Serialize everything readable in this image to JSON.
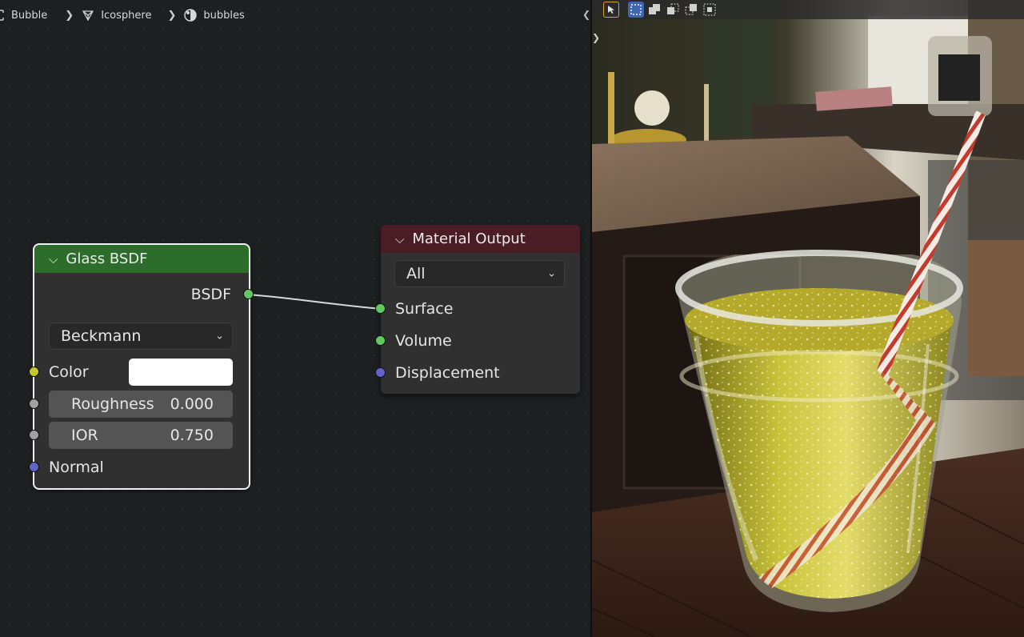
{
  "breadcrumb": {
    "items": [
      {
        "label": "Bubble",
        "icon": "object-icon"
      },
      {
        "label": "Icosphere",
        "icon": "mesh-data-icon"
      },
      {
        "label": "bubbles",
        "icon": "material-icon"
      }
    ]
  },
  "glass_node": {
    "title": "Glass BSDF",
    "header_color": "#2c6d2c",
    "output_label": "BSDF",
    "distribution": "Beckmann",
    "color_label": "Color",
    "color_value": "#ffffff",
    "roughness_label": "Roughness",
    "roughness_value": "0.000",
    "ior_label": "IOR",
    "ior_value": "0.750",
    "normal_label": "Normal"
  },
  "output_node": {
    "title": "Material Output",
    "header_color": "#4a1c25",
    "target": "All",
    "inputs": [
      "Surface",
      "Volume",
      "Displacement"
    ]
  },
  "colors": {
    "socket_shader": "#63c763",
    "socket_color": "#c7c729",
    "socket_float": "#a1a1a1",
    "socket_vector": "#6363c7",
    "selected_outline": "#f0f0f0"
  },
  "viewport": {
    "tools": [
      "select-cursor-icon",
      "select-box-icon",
      "extend-selection-icon",
      "subtract-selection-icon",
      "invert-selection-icon",
      "intersect-selection-icon"
    ],
    "scene": "rendered glass of sparkling liquid with striped straw on a wooden table"
  }
}
